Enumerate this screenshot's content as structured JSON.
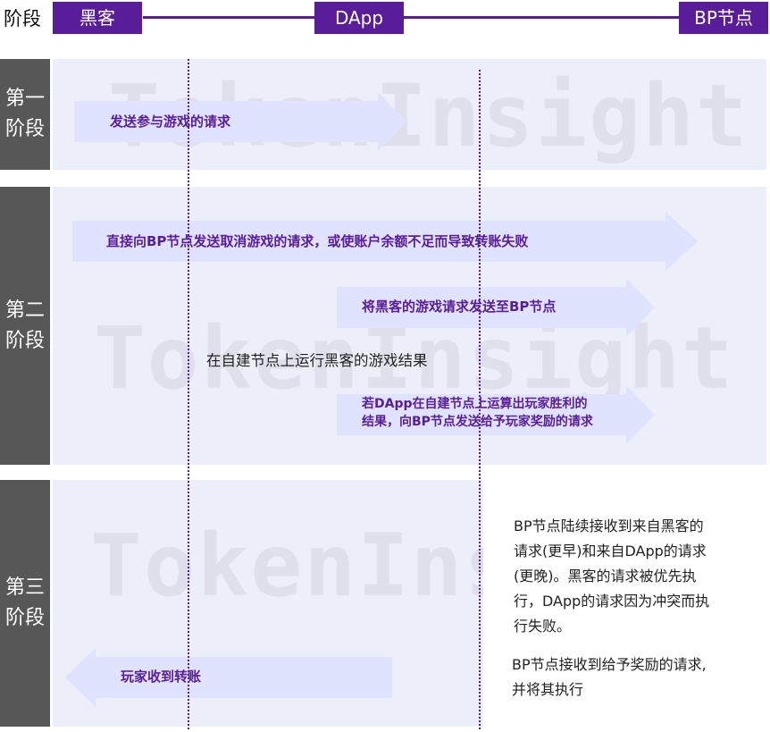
{
  "header": {
    "stage_label": "阶段",
    "hacker": "黑客",
    "dapp": "DApp",
    "bp": "BP节点"
  },
  "colors": {
    "accent": "#5a1d99",
    "panel": "#eceef9",
    "arrow": "#dfe3fd",
    "stage": "#575757"
  },
  "watermark": "TokenInsight",
  "stages": [
    {
      "line1": "第一",
      "line2": "阶段"
    },
    {
      "line1": "第二",
      "line2": "阶段"
    },
    {
      "line1": "第三",
      "line2": "阶段"
    }
  ],
  "stage1": {
    "arrow1": "发送参与游戏的请求"
  },
  "stage2": {
    "arrow1": "直接向BP节点发送取消游戏的请求，或使账户余额不足而导致转账失败",
    "arrow2": "将黑客的游戏请求发送至BP节点",
    "note": "在自建节点上运行黑客的游戏结果",
    "arrow3_line1": "若DApp在自建节点上运算出玩家胜利的",
    "arrow3_line2": "结果，向BP节点发送给予玩家奖励的请求"
  },
  "stage3": {
    "note1_l1": "BP节点陆续接收到来自黑客的",
    "note1_l2": "请求(更早)和来自DApp的请求",
    "note1_l3": "(更晚)。黑客的请求被优先执",
    "note1_l4": "行，DApp的请求因为冲突而执",
    "note1_l5": "行失败。",
    "note2_l1": "BP节点接收到给予奖励的请求,",
    "note2_l2": "并将其执行",
    "arrow1": "玩家收到转账"
  }
}
